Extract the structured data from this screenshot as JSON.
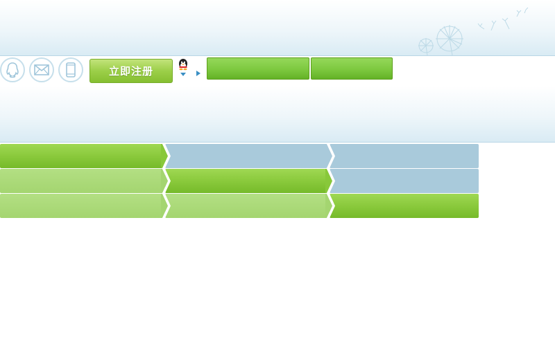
{
  "toolbar": {
    "register_label": "立即注册",
    "icons": [
      "qq-penguin-icon",
      "mail-icon",
      "mobile-phone-icon"
    ]
  },
  "colors": {
    "green": "#88c83a",
    "light_green": "#a4d570",
    "blue_gray": "#a9cadb",
    "banner": "#e6f1f7"
  },
  "steps": {
    "rows": [
      [
        "active",
        "pending",
        "pending"
      ],
      [
        "done",
        "active",
        "pending"
      ],
      [
        "done",
        "done",
        "active"
      ]
    ]
  }
}
